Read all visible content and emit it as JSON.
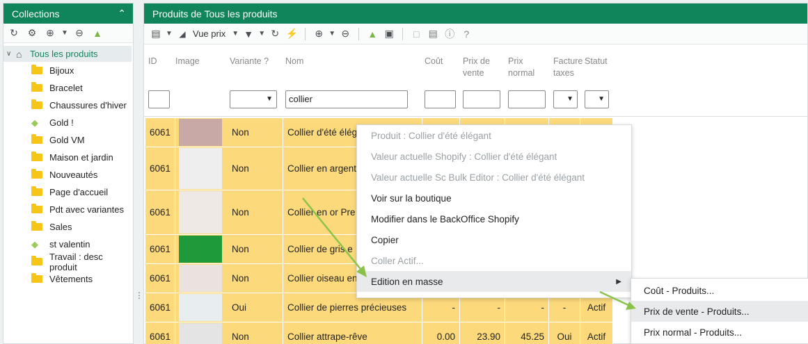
{
  "left_panel": {
    "title": "Collections",
    "root_label": "Tous les produits",
    "items": [
      {
        "label": "Bijoux",
        "icon": "folder"
      },
      {
        "label": "Bracelet",
        "icon": "folder"
      },
      {
        "label": "Chaussures d'hiver",
        "icon": "folder"
      },
      {
        "label": "Gold !",
        "icon": "tag"
      },
      {
        "label": "Gold VM",
        "icon": "folder"
      },
      {
        "label": "Maison et jardin",
        "icon": "folder"
      },
      {
        "label": "Nouveautés",
        "icon": "folder"
      },
      {
        "label": "Page d'accueil",
        "icon": "folder"
      },
      {
        "label": "Pdt avec variantes",
        "icon": "folder"
      },
      {
        "label": "Sales",
        "icon": "folder"
      },
      {
        "label": "st valentin",
        "icon": "tag"
      },
      {
        "label": "Travail : desc produit",
        "icon": "folder"
      },
      {
        "label": "Vêtements",
        "icon": "folder"
      }
    ]
  },
  "right_panel": {
    "title": "Produits de Tous les produits",
    "view_label": "Vue prix",
    "columns": {
      "id": "ID",
      "image": "Image",
      "variante": "Variante ?",
      "nom": "Nom",
      "cout": "Coût",
      "prix_vente_1": "Prix de",
      "prix_vente_2": "vente",
      "prix_normal_1": "Prix",
      "prix_normal_2": "normal",
      "facture_1": "Facture",
      "facture_2": "taxes",
      "statut": "Statut"
    },
    "filter_nom_value": "collier"
  },
  "rows": [
    {
      "id": "6061",
      "variante": "Non",
      "nom": "Collier d'été élégant",
      "cout": "",
      "pv": "",
      "pn": "",
      "fac": "",
      "statut": "",
      "img": "#c9a9a6"
    },
    {
      "id": "6061",
      "variante": "Non",
      "nom": "Collier en argent",
      "cout": "",
      "pv": "",
      "pn": "",
      "fac": "",
      "statut": "",
      "img": "#eeeeee"
    },
    {
      "id": "6061",
      "variante": "Non",
      "nom": "Collier en or Pre",
      "cout": "",
      "pv": "",
      "pn": "",
      "fac": "",
      "statut": "",
      "img": "#efe9e6"
    },
    {
      "id": "6061",
      "variante": "Non",
      "nom": "Collier de gris e",
      "cout": "",
      "pv": "",
      "pn": "",
      "fac": "",
      "statut": "",
      "img": "#1f9a3a"
    },
    {
      "id": "6061",
      "variante": "Non",
      "nom": "Collier oiseau en",
      "cout": "",
      "pv": "",
      "pn": "",
      "fac": "",
      "statut": "",
      "img": "#e9e2de"
    },
    {
      "id": "6061",
      "variante": "Oui",
      "nom": "Collier de pierres précieuses",
      "cout": "-",
      "pv": "-",
      "pn": "-",
      "fac": "-",
      "statut": "Actif",
      "img": "#e8eef0"
    },
    {
      "id": "6061",
      "variante": "Non",
      "nom": "Collier attrape-rêve",
      "cout": "0.00",
      "pv": "23.90",
      "pn": "45.25",
      "fac": "Oui",
      "statut": "Actif",
      "img": "#e4e4e4"
    }
  ],
  "context_menu": {
    "items": [
      {
        "label": "Produit : Collier d'été élégant",
        "disabled": true
      },
      {
        "label": "Valeur actuelle Shopify : Collier d'été élégant",
        "disabled": true
      },
      {
        "label": "Valeur actuelle Sc Bulk Editor : Collier d'été élégant",
        "disabled": true
      },
      {
        "label": "Voir sur la boutique",
        "disabled": false
      },
      {
        "label": "Modifier dans le BackOffice Shopify",
        "disabled": false
      },
      {
        "label": "Copier",
        "disabled": false
      },
      {
        "label": "Coller Actif...",
        "disabled": true
      },
      {
        "label": "Edition en masse",
        "disabled": false
      }
    ],
    "submenu": [
      {
        "label": "Coût - Produits..."
      },
      {
        "label": "Prix de vente - Produits..."
      },
      {
        "label": "Prix normal - Produits..."
      }
    ]
  },
  "colors": {
    "accent": "#10845b",
    "row_highlight": "#fcd97b",
    "arrow": "#8bc34a"
  }
}
